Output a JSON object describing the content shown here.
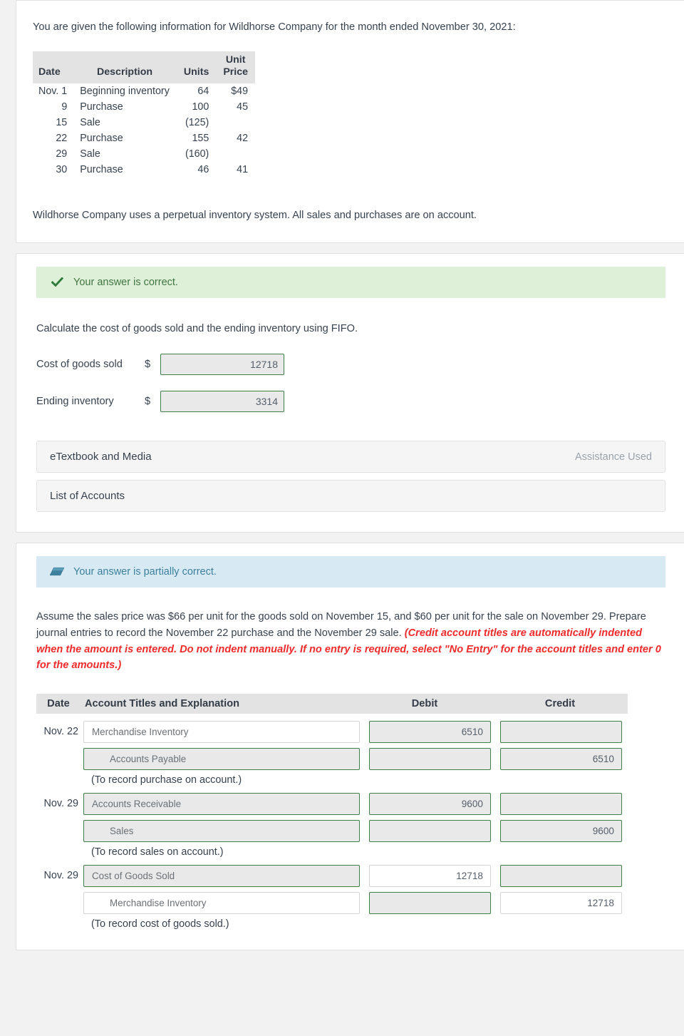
{
  "problem": {
    "intro": "You are given the following information for Wildhorse Company for the month ended November 30, 2021:",
    "table": {
      "headers": {
        "date": "Date",
        "description": "Description",
        "units": "Units",
        "unit_price_line1": "Unit",
        "unit_price_line2": "Price"
      },
      "rows": [
        {
          "date": "Nov. 1",
          "description": "Beginning inventory",
          "units": "64",
          "price": "$49"
        },
        {
          "date": "9",
          "description": "Purchase",
          "units": "100",
          "price": "45"
        },
        {
          "date": "15",
          "description": "Sale",
          "units": "(125)",
          "price": ""
        },
        {
          "date": "22",
          "description": "Purchase",
          "units": "155",
          "price": "42"
        },
        {
          "date": "29",
          "description": "Sale",
          "units": "(160)",
          "price": ""
        },
        {
          "date": "30",
          "description": "Purchase",
          "units": "46",
          "price": "41"
        }
      ]
    },
    "note": "Wildhorse Company uses a perpetual inventory system. All sales and purchases are on account."
  },
  "part_a": {
    "banner": {
      "icon": "check-icon",
      "text": "Your answer is correct.",
      "bg": "#dff0d8",
      "fg": "#3f7542"
    },
    "prompt": "Calculate the cost of goods sold and the ending inventory using FIFO.",
    "fields": [
      {
        "label": "Cost of goods sold",
        "currency": "$",
        "value": "12718"
      },
      {
        "label": "Ending inventory",
        "currency": "$",
        "value": "3314"
      }
    ],
    "accordions": [
      {
        "label": "eTextbook and Media",
        "right": "Assistance Used"
      },
      {
        "label": "List of Accounts",
        "right": ""
      }
    ]
  },
  "part_b": {
    "banner": {
      "icon": "eraser-icon",
      "text": "Your answer is partially correct.",
      "bg": "#d7eaf3",
      "fg": "#3d7f9c"
    },
    "instruction_plain": "Assume the sales price was $66 per unit for the goods sold on November 15, and $60 per unit for the sale on November 29. Prepare journal entries to record the November 22 purchase and the November 29 sale. ",
    "instruction_red": "(Credit account titles are automatically indented when the amount is entered. Do not indent manually. If no entry is required, select \"No Entry\" for the account titles and enter 0 for the amounts.)",
    "journal": {
      "headers": {
        "date": "Date",
        "account": "Account Titles and Explanation",
        "debit": "Debit",
        "credit": "Credit"
      },
      "entries": [
        {
          "lines": [
            {
              "date": "Nov. 22",
              "account": "Merchandise Inventory",
              "indent": false,
              "account_state": "plain",
              "debit": "6510",
              "debit_state": "green",
              "credit": "",
              "credit_state": "green"
            },
            {
              "date": "",
              "account": "Accounts Payable",
              "indent": true,
              "account_state": "green",
              "debit": "",
              "debit_state": "green",
              "credit": "6510",
              "credit_state": "green"
            }
          ],
          "explanation": "(To record purchase on account.)"
        },
        {
          "lines": [
            {
              "date": "Nov. 29",
              "account": "Accounts Receivable",
              "indent": false,
              "account_state": "green",
              "debit": "9600",
              "debit_state": "green",
              "credit": "",
              "credit_state": "green"
            },
            {
              "date": "",
              "account": "Sales",
              "indent": true,
              "account_state": "green",
              "debit": "",
              "debit_state": "green",
              "credit": "9600",
              "credit_state": "green"
            }
          ],
          "explanation": "(To record sales on account.)"
        },
        {
          "lines": [
            {
              "date": "Nov. 29",
              "account": "Cost of Goods Sold",
              "indent": false,
              "account_state": "green",
              "debit": "12718",
              "debit_state": "plain",
              "credit": "",
              "credit_state": "green"
            },
            {
              "date": "",
              "account": "Merchandise Inventory",
              "indent": true,
              "account_state": "plain",
              "debit": "",
              "debit_state": "green",
              "credit": "12718",
              "credit_state": "plain"
            }
          ],
          "explanation": "(To record cost of goods sold.)"
        }
      ]
    }
  }
}
